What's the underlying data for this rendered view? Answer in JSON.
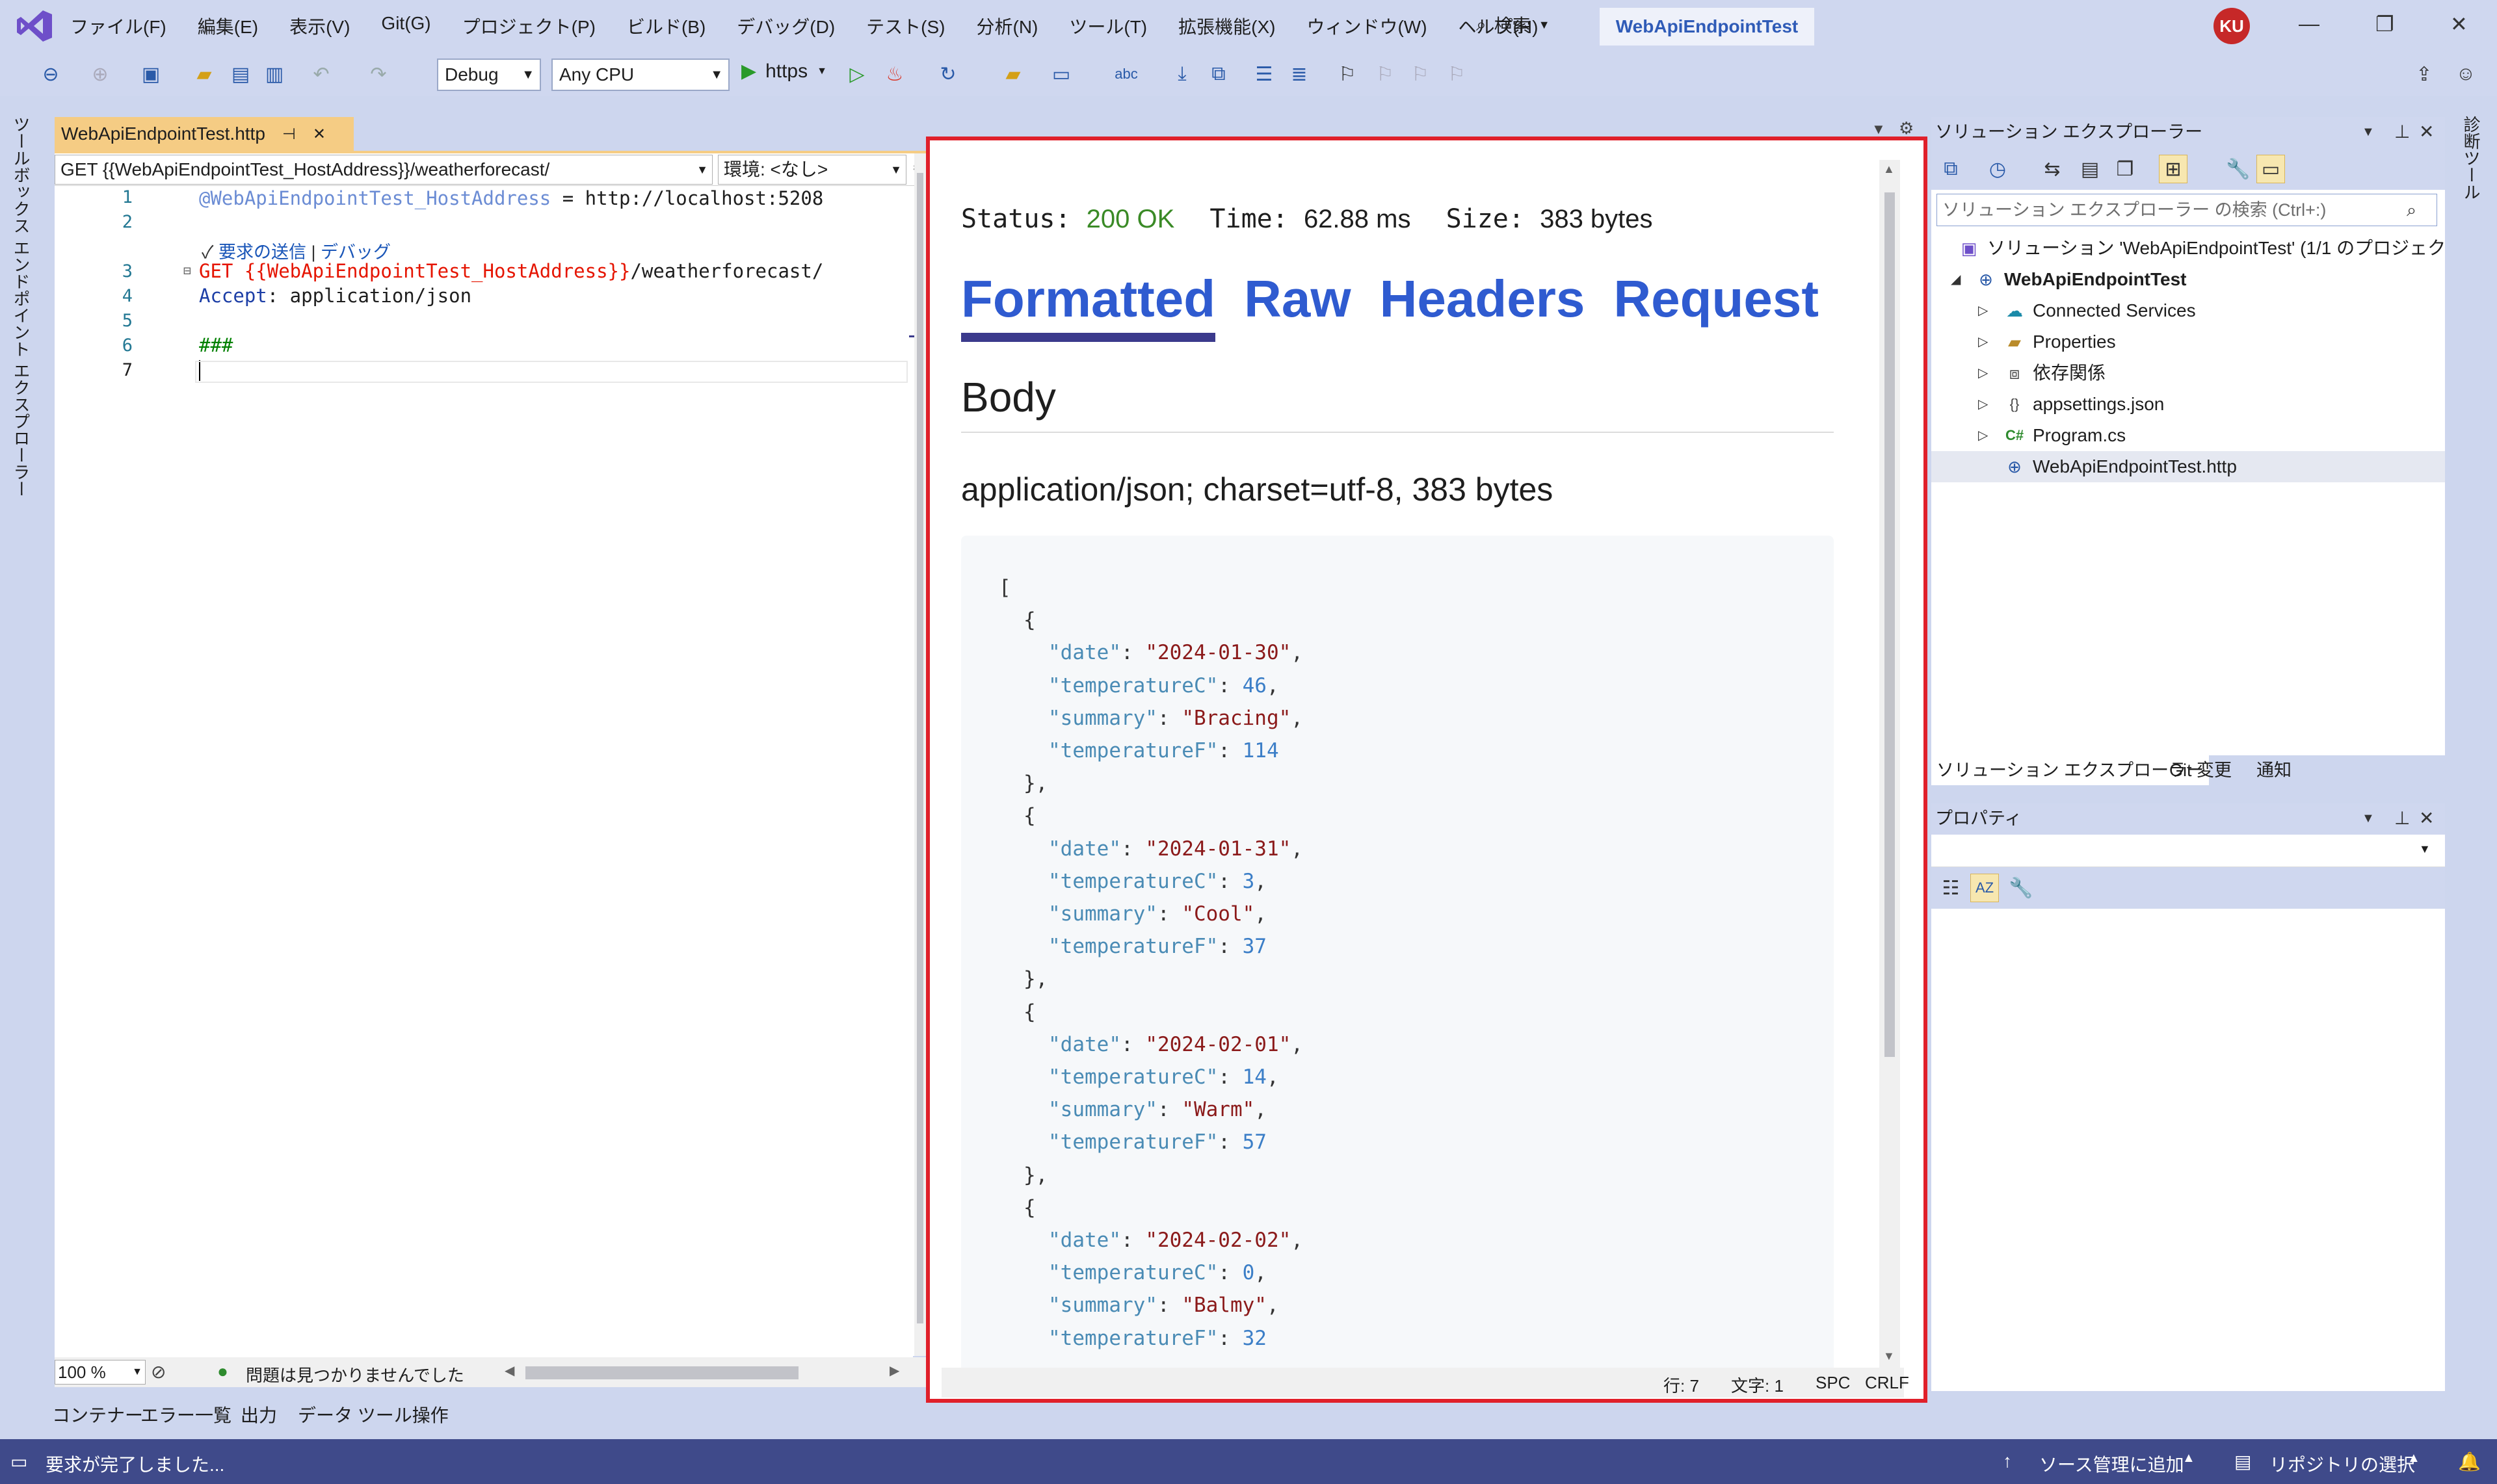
{
  "window": {
    "title": "WebApiEndpointTest",
    "user_initials": "KU"
  },
  "menu": [
    "ファイル(F)",
    "編集(E)",
    "表示(V)",
    "Git(G)",
    "プロジェクト(P)",
    "ビルド(B)",
    "デバッグ(D)",
    "テスト(S)",
    "分析(N)",
    "ツール(T)",
    "拡張機能(X)",
    "ウィンドウ(W)",
    "ヘルプ(H)"
  ],
  "search": {
    "label": "検索"
  },
  "toolbar": {
    "config": "Debug",
    "platform": "Any CPU",
    "run_target": "https"
  },
  "left_rail": {
    "toolbox": "ツールボックス",
    "endpoint_explorer": "エンドポイント エクスプローラー"
  },
  "right_rail": {
    "diagnostics": "診断ツール"
  },
  "editor": {
    "tab_title": "WebApiEndpointTest.http",
    "nav_request": "GET {{WebApiEndpointTest_HostAddress}}/weatherforecast/",
    "nav_env": "環境: <なし>",
    "codelens_send": "要求の送信",
    "codelens_sep": "|",
    "codelens_debug": "デバッグ",
    "line_numbers": [
      "1",
      "2",
      "3",
      "4",
      "5",
      "6",
      "7"
    ],
    "line1_var": "@WebApiEndpointTest_HostAddress",
    "line1_rest": " = http://localhost:5208",
    "line3_method": "GET ",
    "line3_var": "{{WebApiEndpointTest_HostAddress}}",
    "line3_path": "/weatherforecast/",
    "line4_header": "Accept",
    "line4_value": ": application/json",
    "line6_sep": "###",
    "zoom": "100 %",
    "issues": "問題は見つかりませんでした"
  },
  "response": {
    "status_label": "Status:",
    "status_value": "200 OK",
    "time_label": "Time:",
    "time_value": "62.88 ms",
    "size_label": "Size:",
    "size_value": "383 bytes",
    "tabs": [
      "Formatted",
      "Raw",
      "Headers",
      "Request"
    ],
    "active_tab": "Formatted",
    "body_heading": "Body",
    "content_type": "application/json; charset=utf-8, 383 bytes",
    "json_lines": [
      {
        "indent": 0,
        "parts": [
          [
            "p",
            "["
          ]
        ]
      },
      {
        "indent": 1,
        "parts": [
          [
            "p",
            "{"
          ]
        ]
      },
      {
        "indent": 2,
        "parts": [
          [
            "k",
            "\"date\""
          ],
          [
            "p",
            ": "
          ],
          [
            "s",
            "\"2024-01-30\""
          ],
          [
            "p",
            ","
          ]
        ]
      },
      {
        "indent": 2,
        "parts": [
          [
            "k",
            "\"temperatureC\""
          ],
          [
            "p",
            ": "
          ],
          [
            "n",
            "46"
          ],
          [
            "p",
            ","
          ]
        ]
      },
      {
        "indent": 2,
        "parts": [
          [
            "k",
            "\"summary\""
          ],
          [
            "p",
            ": "
          ],
          [
            "s",
            "\"Bracing\""
          ],
          [
            "p",
            ","
          ]
        ]
      },
      {
        "indent": 2,
        "parts": [
          [
            "k",
            "\"temperatureF\""
          ],
          [
            "p",
            ": "
          ],
          [
            "n",
            "114"
          ]
        ]
      },
      {
        "indent": 1,
        "parts": [
          [
            "p",
            "},"
          ]
        ]
      },
      {
        "indent": 1,
        "parts": [
          [
            "p",
            "{"
          ]
        ]
      },
      {
        "indent": 2,
        "parts": [
          [
            "k",
            "\"date\""
          ],
          [
            "p",
            ": "
          ],
          [
            "s",
            "\"2024-01-31\""
          ],
          [
            "p",
            ","
          ]
        ]
      },
      {
        "indent": 2,
        "parts": [
          [
            "k",
            "\"temperatureC\""
          ],
          [
            "p",
            ": "
          ],
          [
            "n",
            "3"
          ],
          [
            "p",
            ","
          ]
        ]
      },
      {
        "indent": 2,
        "parts": [
          [
            "k",
            "\"summary\""
          ],
          [
            "p",
            ": "
          ],
          [
            "s",
            "\"Cool\""
          ],
          [
            "p",
            ","
          ]
        ]
      },
      {
        "indent": 2,
        "parts": [
          [
            "k",
            "\"temperatureF\""
          ],
          [
            "p",
            ": "
          ],
          [
            "n",
            "37"
          ]
        ]
      },
      {
        "indent": 1,
        "parts": [
          [
            "p",
            "},"
          ]
        ]
      },
      {
        "indent": 1,
        "parts": [
          [
            "p",
            "{"
          ]
        ]
      },
      {
        "indent": 2,
        "parts": [
          [
            "k",
            "\"date\""
          ],
          [
            "p",
            ": "
          ],
          [
            "s",
            "\"2024-02-01\""
          ],
          [
            "p",
            ","
          ]
        ]
      },
      {
        "indent": 2,
        "parts": [
          [
            "k",
            "\"temperatureC\""
          ],
          [
            "p",
            ": "
          ],
          [
            "n",
            "14"
          ],
          [
            "p",
            ","
          ]
        ]
      },
      {
        "indent": 2,
        "parts": [
          [
            "k",
            "\"summary\""
          ],
          [
            "p",
            ": "
          ],
          [
            "s",
            "\"Warm\""
          ],
          [
            "p",
            ","
          ]
        ]
      },
      {
        "indent": 2,
        "parts": [
          [
            "k",
            "\"temperatureF\""
          ],
          [
            "p",
            ": "
          ],
          [
            "n",
            "57"
          ]
        ]
      },
      {
        "indent": 1,
        "parts": [
          [
            "p",
            "},"
          ]
        ]
      },
      {
        "indent": 1,
        "parts": [
          [
            "p",
            "{"
          ]
        ]
      },
      {
        "indent": 2,
        "parts": [
          [
            "k",
            "\"date\""
          ],
          [
            "p",
            ": "
          ],
          [
            "s",
            "\"2024-02-02\""
          ],
          [
            "p",
            ","
          ]
        ]
      },
      {
        "indent": 2,
        "parts": [
          [
            "k",
            "\"temperatureC\""
          ],
          [
            "p",
            ": "
          ],
          [
            "n",
            "0"
          ],
          [
            "p",
            ","
          ]
        ]
      },
      {
        "indent": 2,
        "parts": [
          [
            "k",
            "\"summary\""
          ],
          [
            "p",
            ": "
          ],
          [
            "s",
            "\"Balmy\""
          ],
          [
            "p",
            ","
          ]
        ]
      },
      {
        "indent": 2,
        "parts": [
          [
            "k",
            "\"temperatureF\""
          ],
          [
            "p",
            ": "
          ],
          [
            "n",
            "32"
          ]
        ]
      }
    ],
    "status_line": "行: 7",
    "status_col": "文字: 1",
    "status_spc": "SPC",
    "status_crlf": "CRLF"
  },
  "solution_explorer": {
    "title": "ソリューション エクスプローラー",
    "search_placeholder": "ソリューション エクスプローラー の検索 (Ctrl+:)",
    "solution": "ソリューション 'WebApiEndpointTest' (1/1 のプロジェクト)",
    "project": "WebApiEndpointTest",
    "items": [
      "Connected Services",
      "Properties",
      "依存関係",
      "appsettings.json",
      "Program.cs",
      "WebApiEndpointTest.http"
    ],
    "bottom_tabs": [
      "ソリューション エクスプローラー",
      "Git 変更",
      "通知"
    ]
  },
  "properties": {
    "title": "プロパティ"
  },
  "bottom_tabs": [
    "コンテナー",
    "エラー一覧",
    "出力",
    "データ ツール操作"
  ],
  "statusbar": {
    "message": "要求が完了しました...",
    "source_control": "ソース管理に追加",
    "repository": "リポジトリの選択"
  },
  "colors": {
    "accent": "#2f5bd0",
    "ok": "#3a8a26",
    "highlight_border": "#e0202a",
    "status_bar": "#3f4a8a"
  }
}
